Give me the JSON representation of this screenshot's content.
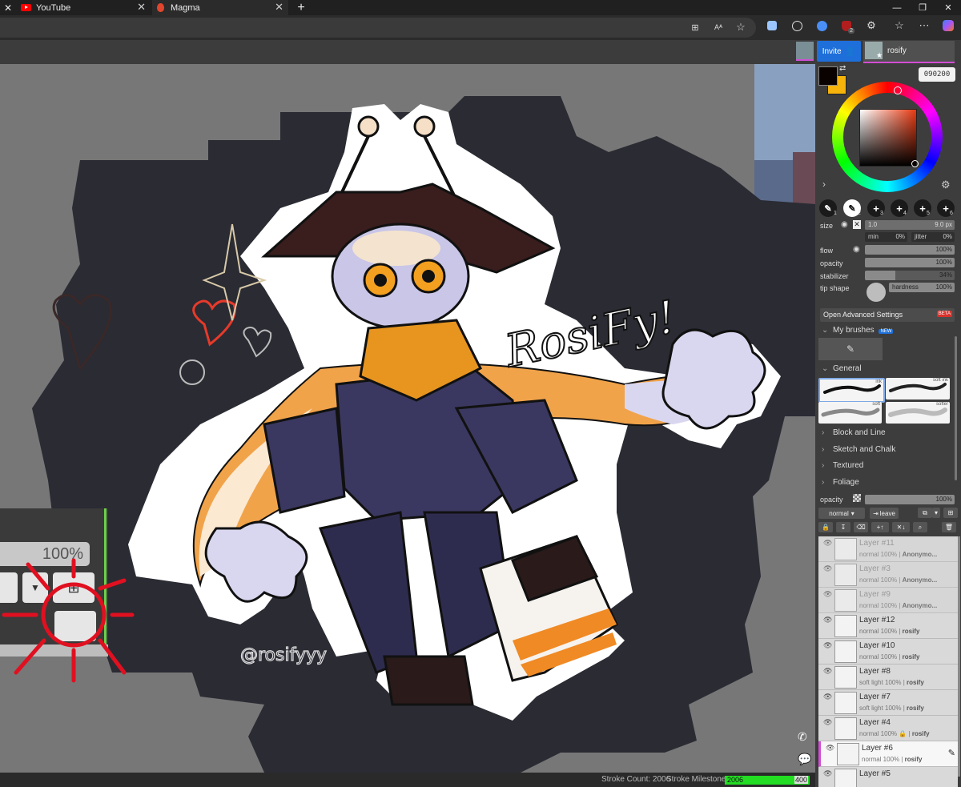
{
  "browser": {
    "tabs": [
      {
        "title": "YouTube",
        "active": false
      },
      {
        "title": "Magma",
        "active": true
      }
    ],
    "new_tab": "+",
    "window_controls": [
      "—",
      "❐",
      "✕"
    ],
    "url_icons": [
      "⊞",
      "Aᴬ",
      "☆"
    ],
    "ext_badges": [
      "2"
    ]
  },
  "app": {
    "invite_label": "Invite",
    "user_name": "rosify",
    "hex_value": "090200",
    "colors": {
      "primary": "#090200",
      "secondary": "#F5B30C",
      "accent": "#1e6fd9",
      "user_accent": "#d14dd4",
      "status_green": "#22dd22"
    }
  },
  "brush": {
    "slots": [
      "1",
      "2",
      "3",
      "4",
      "5",
      "6"
    ],
    "size_label": "size",
    "size_min_value": "1.0",
    "size_max_value": "9.0 px",
    "min_label": "min",
    "min_value": "0%",
    "jitter_label": "jitter",
    "jitter_value": "0%",
    "flow_label": "flow",
    "flow_value": "100%",
    "flow_fill": 1.0,
    "opacity_label": "opacity",
    "opacity_value": "100%",
    "opacity_fill": 1.0,
    "stabilizer_label": "stabilizer",
    "stabilizer_value": "34%",
    "stabilizer_fill": 0.34,
    "tip_label": "tip shape",
    "hardness_label": "hardness",
    "hardness_value": "100%",
    "advanced_label": "Open Advanced Settings",
    "beta_label": "BETA"
  },
  "brush_library": {
    "my_brushes_label": "My brushes",
    "my_brushes_badge": "NEW",
    "general_label": "General",
    "presets": [
      "ink",
      "soft ink",
      "soft",
      "softer"
    ],
    "categories": [
      "Block and Line",
      "Sketch and Chalk",
      "Textured",
      "Foliage"
    ]
  },
  "layers_panel": {
    "opacity_label": "opacity",
    "opacity_value": "100%",
    "blend_mode": "normal",
    "leave_label": "leave",
    "layers": [
      {
        "name": "Layer #11",
        "meta": "normal 100% | ",
        "owner": "Anonymo...",
        "dim": true
      },
      {
        "name": "Layer #3",
        "meta": "normal 100% | ",
        "owner": "Anonymo...",
        "dim": true
      },
      {
        "name": "Layer #9",
        "meta": "normal 100% | ",
        "owner": "Anonymo...",
        "dim": true
      },
      {
        "name": "Layer #12",
        "meta": "normal 100% | ",
        "owner": "rosify",
        "dim": false
      },
      {
        "name": "Layer #10",
        "meta": "normal 100% | ",
        "owner": "rosify",
        "dim": false
      },
      {
        "name": "Layer #8",
        "meta": "soft light 100% | ",
        "owner": "rosify",
        "dim": false
      },
      {
        "name": "Layer #7",
        "meta": "soft light 100% | ",
        "owner": "rosify",
        "dim": false
      },
      {
        "name": "Layer #4",
        "meta": "normal 100% 🔒 | ",
        "owner": "rosify",
        "dim": false
      },
      {
        "name": "Layer #6",
        "meta": "normal 100% | ",
        "owner": "rosify",
        "dim": false,
        "selected": true
      },
      {
        "name": "Layer #5",
        "meta": "",
        "owner": "",
        "dim": false
      }
    ]
  },
  "artwork": {
    "title_text": "RosiFy!",
    "signature": "@rosifyyy",
    "inset_value": "100%"
  },
  "status": {
    "stroke_count_label": "Stroke Count: 2006",
    "milestone_label": "Stroke Milestone:",
    "milestone_current": "2006",
    "milestone_target": "400",
    "milestone_fill": 1.0
  }
}
